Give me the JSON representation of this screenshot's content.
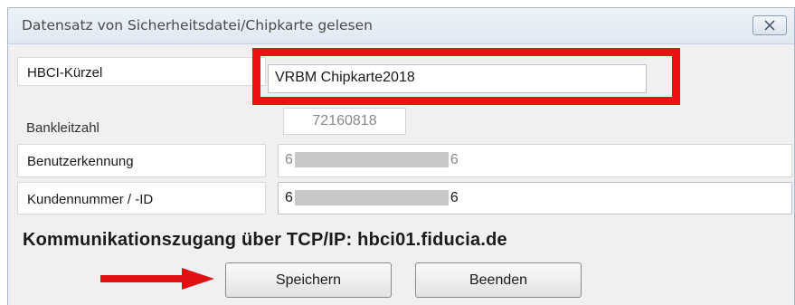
{
  "window": {
    "title": "Datensatz von Sicherheitsdatei/Chipkarte gelesen"
  },
  "form": {
    "hbci_kuerzel": {
      "label": "HBCI-Kürzel",
      "value": "VRBM Chipkarte2018"
    },
    "bankleitzahl": {
      "label": "Bankleitzahl",
      "value": "72160818"
    },
    "benutzerkennung": {
      "label": "Benutzerkennung",
      "value_start": "6",
      "value_end": "6"
    },
    "kundennummer": {
      "label": "Kundennummer / -ID",
      "value_start": "6",
      "value_end": "6"
    }
  },
  "communication": {
    "text": "Kommunikationszugang über TCP/IP: hbci01.fiducia.de"
  },
  "buttons": {
    "save_label": "Speichern",
    "exit_label": "Beenden"
  },
  "colors": {
    "highlight": "#ee1111",
    "arrow": "#e01010"
  },
  "icons": {
    "close": "close-icon",
    "arrow": "arrow-right-icon"
  }
}
